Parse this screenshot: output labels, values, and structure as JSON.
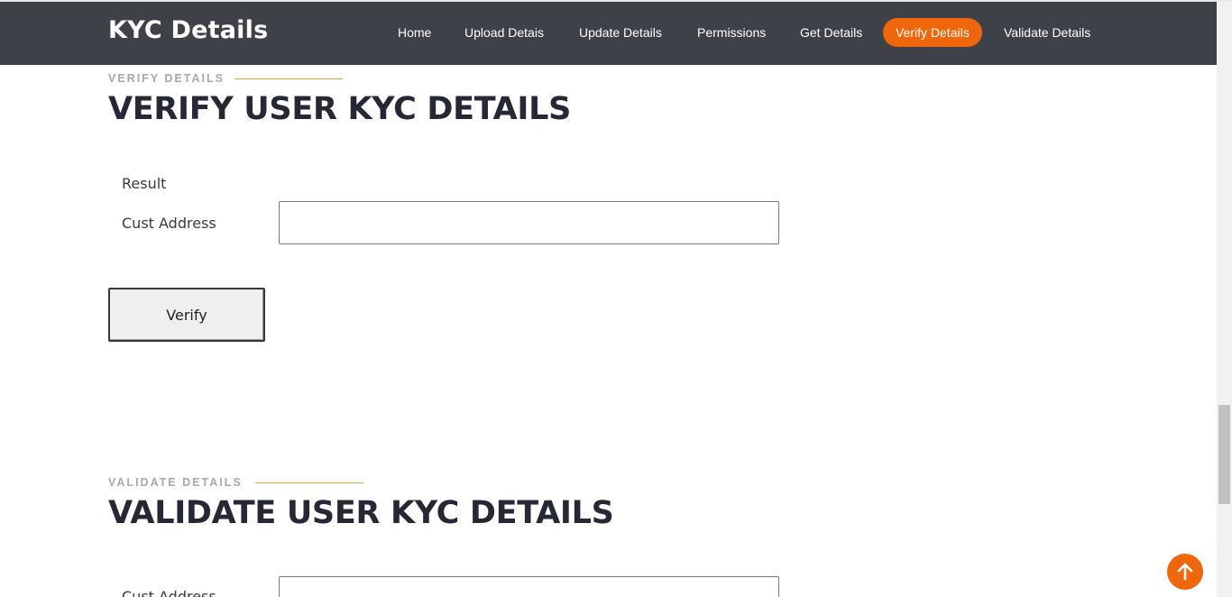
{
  "header": {
    "brand": "KYC Details",
    "nav": [
      {
        "label": "Home",
        "active": false
      },
      {
        "label": "Upload Detais",
        "active": false
      },
      {
        "label": "Update Details",
        "active": false
      },
      {
        "label": "Permissions",
        "active": false
      },
      {
        "label": "Get Details",
        "active": false
      },
      {
        "label": "Verify Details",
        "active": true
      },
      {
        "label": "Validate Details",
        "active": false
      }
    ]
  },
  "verify_section": {
    "eyebrow": "VERIFY DETAILS",
    "title": "VERIFY USER KYC DETAILS",
    "result_label": "Result",
    "address_label": "Cust Address",
    "address_value": "",
    "button_label": "Verify"
  },
  "validate_section": {
    "eyebrow": "VALIDATE DETAILS",
    "title": "VALIDATE USER KYC DETAILS",
    "address_label": "Cust Address",
    "address_value": ""
  },
  "colors": {
    "header_bg": "#3f4149",
    "accent": "#f0660b",
    "heading": "#262935",
    "eyebrow_line": "#e2a03e"
  },
  "icons": {
    "scroll_top": "arrow-up-icon"
  }
}
